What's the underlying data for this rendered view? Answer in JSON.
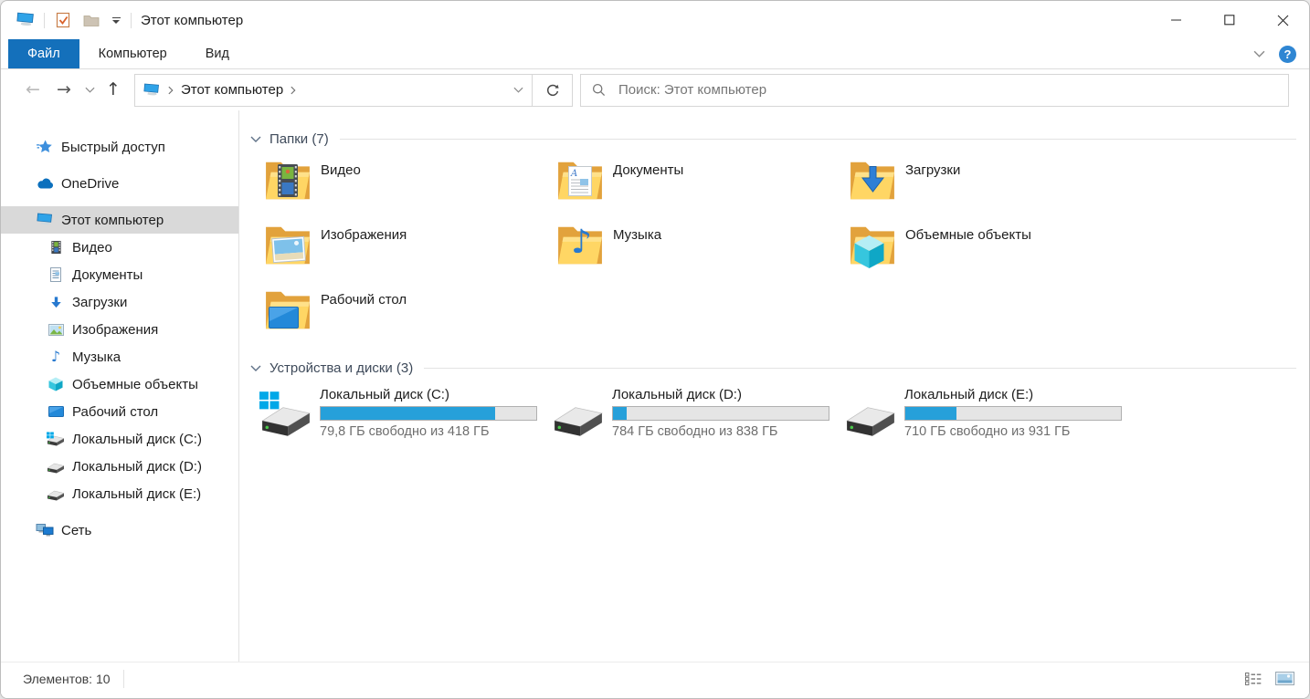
{
  "window": {
    "title": "Этот компьютер",
    "controls": {
      "minimize": "minimize",
      "maximize": "maximize",
      "close": "close"
    }
  },
  "ribbon": {
    "tabs": [
      {
        "label": "Файл",
        "active": true
      },
      {
        "label": "Компьютер",
        "active": false
      },
      {
        "label": "Вид",
        "active": false
      }
    ],
    "help_glyph": "?"
  },
  "navbar": {
    "breadcrumb_root": "Этот компьютер",
    "search_placeholder": "Поиск: Этот компьютер"
  },
  "icons": {
    "back-arrow": "←",
    "forward-arrow": "→",
    "up-arrow": "↑",
    "music-note": "♪",
    "qat": [
      "computer-icon",
      "properties-check-icon",
      "new-folder-icon",
      "customize-qat-dropdown-icon"
    ],
    "search": "search-icon",
    "refresh": "refresh-icon"
  },
  "sidebar": {
    "items": [
      {
        "label": "Быстрый доступ",
        "icon": "quick-access-star",
        "level": 0,
        "selected": false
      },
      {
        "label": "OneDrive",
        "icon": "onedrive-cloud",
        "level": 0,
        "selected": false
      },
      {
        "label": "Этот компьютер",
        "icon": "this-pc-monitor",
        "level": 0,
        "selected": true
      },
      {
        "label": "Видео",
        "icon": "videos",
        "level": 1,
        "selected": false
      },
      {
        "label": "Документы",
        "icon": "documents",
        "level": 1,
        "selected": false
      },
      {
        "label": "Загрузки",
        "icon": "downloads",
        "level": 1,
        "selected": false
      },
      {
        "label": "Изображения",
        "icon": "pictures",
        "level": 1,
        "selected": false
      },
      {
        "label": "Музыка",
        "icon": "music",
        "level": 1,
        "selected": false
      },
      {
        "label": "Объемные объекты",
        "icon": "3d-objects",
        "level": 1,
        "selected": false
      },
      {
        "label": "Рабочий стол",
        "icon": "desktop",
        "level": 1,
        "selected": false
      },
      {
        "label": "Локальный диск (C:)",
        "icon": "drive-windows",
        "level": 1,
        "selected": false
      },
      {
        "label": "Локальный диск (D:)",
        "icon": "drive",
        "level": 1,
        "selected": false
      },
      {
        "label": "Локальный диск (E:)",
        "icon": "drive",
        "level": 1,
        "selected": false
      },
      {
        "label": "Сеть",
        "icon": "network",
        "level": 0,
        "selected": false
      }
    ]
  },
  "main": {
    "folders_header": "Папки (7)",
    "folders": [
      {
        "name": "Видео",
        "icon": "folder-videos"
      },
      {
        "name": "Документы",
        "icon": "folder-documents"
      },
      {
        "name": "Загрузки",
        "icon": "folder-downloads"
      },
      {
        "name": "Изображения",
        "icon": "folder-pictures"
      },
      {
        "name": "Музыка",
        "icon": "folder-music"
      },
      {
        "name": "Объемные объекты",
        "icon": "folder-3d-objects"
      },
      {
        "name": "Рабочий стол",
        "icon": "folder-desktop"
      }
    ],
    "drives_header": "Устройства и диски (3)",
    "drives": [
      {
        "name": "Локальный диск (C:)",
        "free": "79,8 ГБ свободно из 418 ГБ",
        "used_percent": 80.9,
        "windows_logo": true
      },
      {
        "name": "Локальный диск (D:)",
        "free": "784 ГБ свободно из 838 ГБ",
        "used_percent": 6.4,
        "windows_logo": false
      },
      {
        "name": "Локальный диск (E:)",
        "free": "710 ГБ свободно из 931 ГБ",
        "used_percent": 23.7,
        "windows_logo": false
      }
    ]
  },
  "statusbar": {
    "items_count": "Элементов: 10"
  },
  "colors": {
    "accent": "#1470bb",
    "capacity_bar": "#26a0da",
    "selection": "#d9d9d9",
    "group_header_text": "#3e4a5a"
  }
}
